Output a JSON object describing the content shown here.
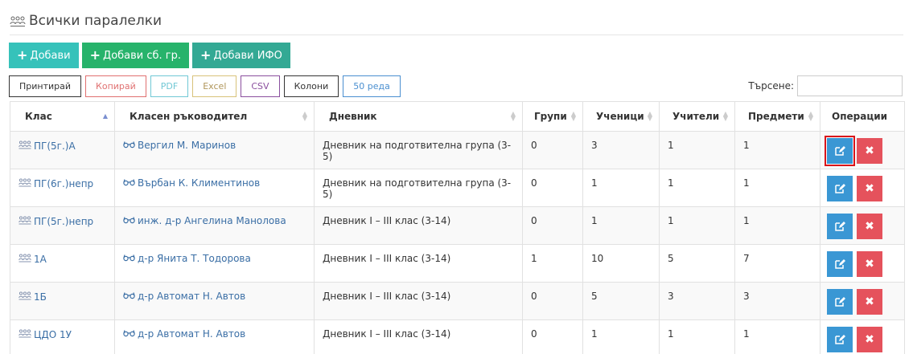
{
  "header": {
    "title": "Всички паралелки",
    "icon": "group-icon"
  },
  "add_buttons": [
    {
      "label": "Добави",
      "color": "#36c2ba"
    },
    {
      "label": "Добави сб. гр.",
      "color": "#27b36b"
    },
    {
      "label": "Добави ИФО",
      "color": "#33a994"
    }
  ],
  "tools": [
    {
      "label": "Принтирай",
      "border": "#333333",
      "color": "#333333"
    },
    {
      "label": "Копирай",
      "border": "#e07070",
      "color": "#e07070"
    },
    {
      "label": "PDF",
      "border": "#71c8d5",
      "color": "#71c8d5"
    },
    {
      "label": "Excel",
      "border": "#d8c27a",
      "color": "#b0965a"
    },
    {
      "label": "CSV",
      "border": "#8a4f9e",
      "color": "#8a4f9e"
    },
    {
      "label": "Колони",
      "border": "#333333",
      "color": "#333333"
    },
    {
      "label": "50 реда",
      "border": "#4a8fd0",
      "color": "#4a8fd0"
    }
  ],
  "search": {
    "label": "Търсене:",
    "value": ""
  },
  "table": {
    "columns": [
      "Клас",
      "Класен ръководител",
      "Дневник",
      "Групи",
      "Ученици",
      "Учители",
      "Предмети",
      "Операции"
    ],
    "rows": [
      {
        "klas": "ПГ(5г.)А",
        "teacher": "Вергил М. Маринов",
        "diary": "Дневник на подготвителна група (3-5)",
        "groups": "0",
        "students": "3",
        "teachers": "1",
        "subjects": "1"
      },
      {
        "klas": "ПГ(6г.)непр",
        "teacher": "Върбан К. Климентинов",
        "diary": "Дневник на подготвителна група (3-5)",
        "groups": "0",
        "students": "1",
        "teachers": "1",
        "subjects": "1"
      },
      {
        "klas": "ПГ(5г.)непр",
        "teacher": "инж. д-р Ангелина Манолова",
        "diary": "Дневник I – III клас (3-14)",
        "groups": "0",
        "students": "1",
        "teachers": "1",
        "subjects": "1"
      },
      {
        "klas": "1А",
        "teacher": "д-р Янита Т. Тодорова",
        "diary": "Дневник I – III клас (3-14)",
        "groups": "1",
        "students": "10",
        "teachers": "5",
        "subjects": "7"
      },
      {
        "klas": "1Б",
        "teacher": "д-р Автомат Н. Автов",
        "diary": "Дневник I – III клас (3-14)",
        "groups": "0",
        "students": "5",
        "teachers": "3",
        "subjects": "3"
      },
      {
        "klas": "ЦДО 1У",
        "teacher": "д-р Автомат Н. Автов",
        "diary": "Дневник I – III клас (3-14)",
        "groups": "0",
        "students": "1",
        "teachers": "1",
        "subjects": "1"
      }
    ]
  },
  "colors": {
    "edit": "#3a97d4",
    "delete": "#e5525c",
    "highlight": "#d9141a",
    "link": "#3a6ea5"
  }
}
